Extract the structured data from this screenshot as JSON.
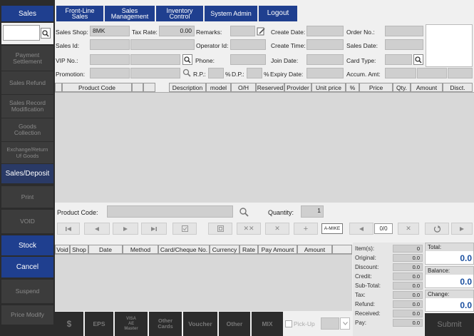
{
  "sidebar": {
    "items": [
      {
        "label": "Sales"
      },
      {
        "label": "Payment\nSettlement"
      },
      {
        "label": "Sales Refund"
      },
      {
        "label": "Sales Record\nModification"
      },
      {
        "label": "Goods\nCollection"
      },
      {
        "label": "Exchange/Return\nUf Goods"
      },
      {
        "label": "Sales/Deposit"
      },
      {
        "label": "Print"
      },
      {
        "label": "VOID"
      },
      {
        "label": "Stock"
      },
      {
        "label": "Cancel"
      },
      {
        "label": "Suspend"
      },
      {
        "label": "Price Modify"
      }
    ]
  },
  "topbar": {
    "tabs": [
      {
        "label": "Front-Line Sales"
      },
      {
        "label": "Sales\nManagement"
      },
      {
        "label": "Inventory\nControl"
      },
      {
        "label": "System Admin"
      },
      {
        "label": "Logout"
      }
    ]
  },
  "form": {
    "sales_shop_label": "Sales Shop:",
    "sales_shop_value": "8MK",
    "tax_rate_label": "Tax Rate:",
    "tax_rate_value": "0.00",
    "remarks_label": "Remarks:",
    "create_date_label": "Create Date:",
    "order_no_label": "Order No.:",
    "sales_id_label": "Sales Id:",
    "operator_id_label": "Operator Id:",
    "create_time_label": "Create Time:",
    "sales_date_label": "Sales Date:",
    "vip_no_label": "VIP No.:",
    "phone_label": "Phone:",
    "join_date_label": "Join Date:",
    "card_type_label": "Card Type:",
    "promotion_label": "Promotion:",
    "rp_label": "R.P.:",
    "pct1": "%",
    "dp_label": "D.P.:",
    "pct2": "%",
    "expiry_date_label": "Expiry Date:",
    "accum_amt_label": "Accum. Amt:"
  },
  "product_table": {
    "columns": [
      "Product Code",
      "",
      "",
      "Description",
      "model",
      "O/H",
      "Reserved",
      "Provider",
      "Unit price",
      "%",
      "Price",
      "Qty.",
      "Amount",
      "Disct."
    ]
  },
  "entry": {
    "product_code_label": "Product Code:",
    "quantity_label": "Quantity:",
    "quantity_value": "1"
  },
  "nav": {
    "amike_label": "A-MIKE",
    "page_counter": "0/0"
  },
  "payment_table": {
    "columns": [
      "Void",
      "Shop",
      "Date",
      "Method",
      "Card/Cheque No.",
      "Currency",
      "Rate",
      "Pay Amount",
      "Amount",
      ""
    ]
  },
  "totals": {
    "rows": [
      {
        "label": "Item(s):",
        "value": "0"
      },
      {
        "label": "Original:",
        "value": "0.0"
      },
      {
        "label": "Discount:",
        "value": "0.0"
      },
      {
        "label": "Credit:",
        "value": "0.0"
      },
      {
        "label": "Sub-Total:",
        "value": "0.0"
      },
      {
        "label": "Tax:",
        "value": "0.0"
      },
      {
        "label": "Refund:",
        "value": "0.0"
      },
      {
        "label": "Received:",
        "value": "0.0"
      },
      {
        "label": "Pay:",
        "value": "0.0"
      }
    ],
    "total_label": "Total:",
    "total_value": "0.0",
    "balance_label": "Balance:",
    "balance_value": "0.0",
    "change_label": "Change:",
    "change_value": "0.0",
    "submit_label": "Submit"
  },
  "payment_methods": {
    "items": [
      {
        "label": "$"
      },
      {
        "label": "EPS"
      },
      {
        "label": "VISA\nAE\nMaster"
      },
      {
        "label": "Other\nCards"
      },
      {
        "label": "Voucher"
      },
      {
        "label": "Other"
      },
      {
        "label": "MIX"
      }
    ],
    "pickup_label": "Pick-Up"
  },
  "colors": {
    "accent": "#1f3f8f",
    "highlight": "#2a58b4",
    "sidebar": "#2c2c2c",
    "field": "#cfcfcf",
    "value_blue": "#1a4fa0"
  }
}
